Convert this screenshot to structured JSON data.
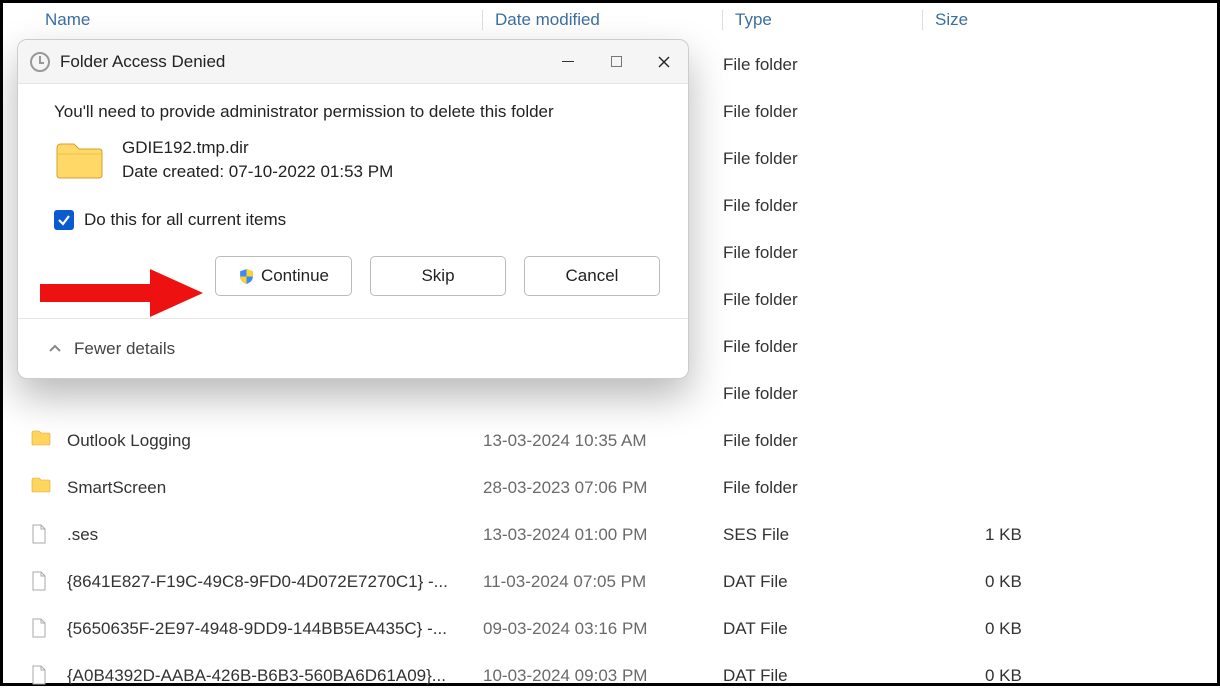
{
  "columns": {
    "name": "Name",
    "date": "Date modified",
    "type": "Type",
    "size": "Size"
  },
  "hidden_rows": [
    {
      "type": "File folder"
    },
    {
      "type": "File folder"
    },
    {
      "type": "File folder"
    },
    {
      "type": "File folder"
    },
    {
      "type": "File folder"
    },
    {
      "type": "File folder"
    },
    {
      "type": "File folder"
    },
    {
      "type": "File folder"
    }
  ],
  "rows": [
    {
      "kind": "folder",
      "name": "Outlook Logging",
      "date": "13-03-2024 10:35 AM",
      "type": "File folder",
      "size": ""
    },
    {
      "kind": "folder",
      "name": "SmartScreen",
      "date": "28-03-2023 07:06 PM",
      "type": "File folder",
      "size": ""
    },
    {
      "kind": "file",
      "name": ".ses",
      "date": "13-03-2024 01:00 PM",
      "type": "SES File",
      "size": "1 KB"
    },
    {
      "kind": "file",
      "name": "{8641E827-F19C-49C8-9FD0-4D072E7270C1} -...",
      "date": "11-03-2024 07:05 PM",
      "type": "DAT File",
      "size": "0 KB"
    },
    {
      "kind": "file",
      "name": "{5650635F-2E97-4948-9DD9-144BB5EA435C} -...",
      "date": "09-03-2024 03:16 PM",
      "type": "DAT File",
      "size": "0 KB"
    },
    {
      "kind": "file",
      "name": "{A0B4392D-AABA-426B-B6B3-560BA6D61A09}...",
      "date": "10-03-2024 09:03 PM",
      "type": "DAT File",
      "size": "0 KB"
    }
  ],
  "dialog": {
    "title": "Folder Access Denied",
    "message": "You'll need to provide administrator permission to delete this folder",
    "item_name": "GDIE192.tmp.dir",
    "item_date": "Date created: 07-10-2022 01:53 PM",
    "checkbox_label": "Do this for all current items",
    "buttons": {
      "continue": "Continue",
      "skip": "Skip",
      "cancel": "Cancel"
    },
    "footer": "Fewer details"
  }
}
